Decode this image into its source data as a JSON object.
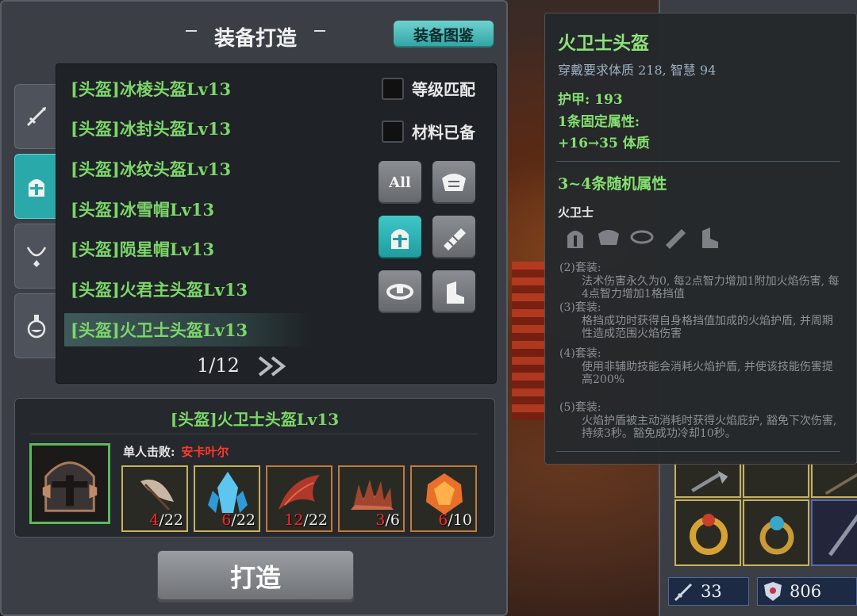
{
  "panel": {
    "title": "装备打造",
    "codex_label": "装备图鉴"
  },
  "recipes": [
    {
      "label": "[头盔]冰棱头盔Lv13"
    },
    {
      "label": "[头盔]冰封头盔Lv13"
    },
    {
      "label": "[头盔]冰纹头盔Lv13"
    },
    {
      "label": "[头盔]冰雪帽Lv13"
    },
    {
      "label": "[头盔]陨星帽Lv13"
    },
    {
      "label": "[头盔]火君主头盔Lv13"
    },
    {
      "label": "[头盔]火卫士头盔Lv13"
    }
  ],
  "filters": {
    "level_match": "等级匹配",
    "materials_ready": "材料已备",
    "all_label": "All"
  },
  "pager": {
    "text": "1/12"
  },
  "selected": {
    "name": "[头盔]火卫士头盔Lv13",
    "drop_label": "单人击败:",
    "drop_boss": "安卡叶尔",
    "materials": [
      {
        "icon": "feather-icon",
        "have": "4",
        "need": "/22"
      },
      {
        "icon": "blue-crystal-icon",
        "have": "6",
        "need": "/22"
      },
      {
        "icon": "red-scale-icon",
        "have": "12",
        "need": "/22"
      },
      {
        "icon": "spiked-shell-icon",
        "have": "3",
        "need": "/6"
      },
      {
        "icon": "fire-gem-icon",
        "have": "6",
        "need": "/10"
      }
    ]
  },
  "craft_label": "打造",
  "tooltip": {
    "name": "火卫士头盔",
    "requirement": "穿戴要求体质 218, 智慧 94",
    "armor": "护甲:  193",
    "fixed_count": "1条固定属性:",
    "fixed_stat": "+16→35 体质",
    "random_attr": "3~4条随机属性",
    "set_name": "火卫士",
    "bonuses": [
      {
        "head": "(2)套装:",
        "desc": "法术伤害永久为0, 每2点智力增加1附加火焰伤害, 每4点智力增加1格挡值"
      },
      {
        "head": "(3)套装:",
        "desc": "格挡成功时获得自身格挡值加成的火焰护盾, 并周期性造成范围火焰伤害"
      },
      {
        "head": "(4)套装:",
        "desc": "使用非辅助技能会消耗火焰护盾, 并使该技能伤害提高200%"
      },
      {
        "head": "(5)套装:",
        "desc": "火焰护盾被主动消耗时获得火焰庇护, 豁免下次伤害, 持续3秒。豁免成功冷却10秒。"
      }
    ]
  },
  "inventory": {
    "stat_attack": "33",
    "stat_defense": "806"
  }
}
